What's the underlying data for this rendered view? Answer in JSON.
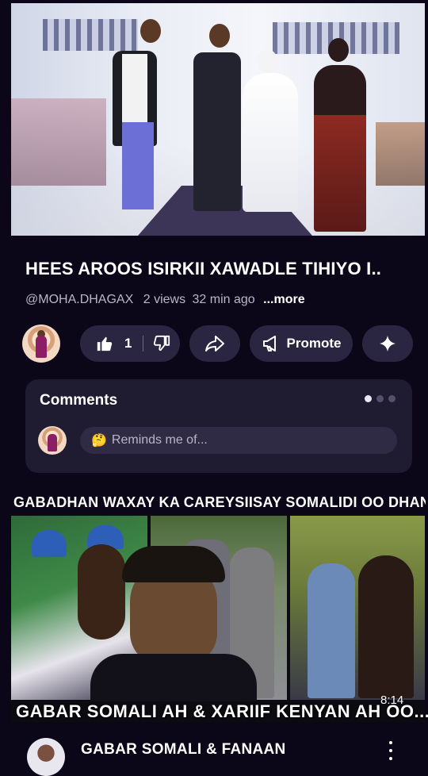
{
  "video": {
    "title": "HEES AROOS ISIRKII XAWADLE TIHIYO I..",
    "channel": "@MOHA.DHAGAX",
    "views": "2 views",
    "age": "32 min ago",
    "more_label": "...more"
  },
  "actions": {
    "like_count": "1",
    "promote_label": "Promote"
  },
  "comments": {
    "title": "Comments",
    "placeholder_emoji": "🤔",
    "placeholder": "Reminds me of..."
  },
  "next_video": {
    "title": "GABADHAN WAXAY KA CAREYSIISAY SOMALIDI OO DHAN😱",
    "caption": "GABAR SOMALI AH & XARIIF KENYAN AH OO...",
    "duration": "8:14",
    "channel_title": "GABAR SOMALI & FANAAN"
  },
  "icons": {
    "like": "thumbs-up-icon",
    "dislike": "thumbs-down-icon",
    "share": "share-icon",
    "promote": "megaphone-icon",
    "remix": "sparkle-icon",
    "menu": "kebab-menu-icon"
  },
  "colors": {
    "background": "#0b0719",
    "pill": "#2a2540",
    "card": "#1f1b30"
  }
}
